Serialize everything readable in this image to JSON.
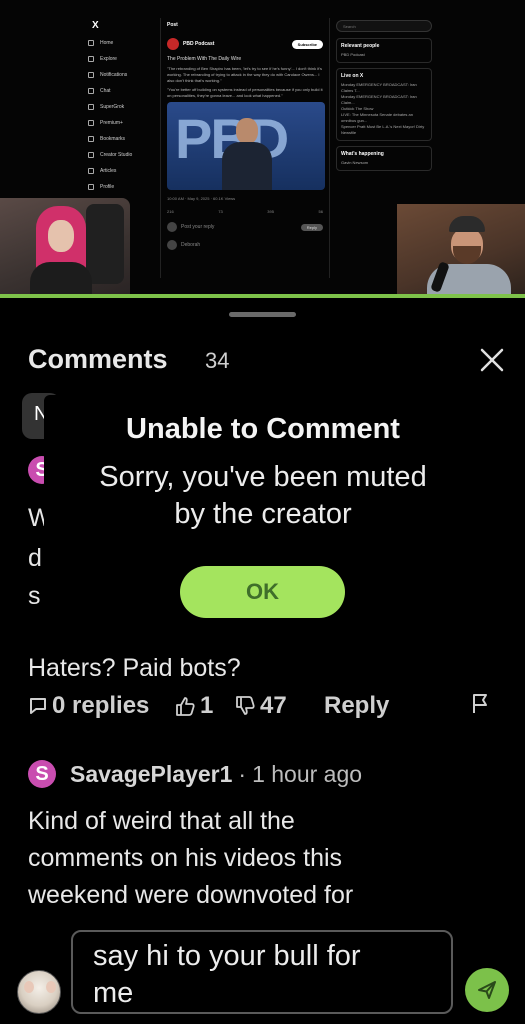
{
  "video": {
    "x_logo": "X",
    "nav": [
      "Home",
      "Explore",
      "Notifications",
      "Chat",
      "SuperGrok",
      "Premium+",
      "Bookmarks",
      "Creator Studio",
      "Articles",
      "Profile"
    ],
    "post": {
      "header": "Post",
      "author": "PBD Podcast",
      "follow": "Subscribe",
      "title": "The Problem With The Daily Wire",
      "text1": "\"The rebranding of Ben Shapiro has been, 'let's try to see if he's funny'... I don't think it's working. The rebranding of trying to attack in the way they do with Candace Owens... I also don't think that's working.\"",
      "text2": "\"You're better off building on systems instead of personalities because if you only build it on personalities, they're gonna leave... and look what happened.\"",
      "image_word": "PBD",
      "meta": "10:00 AM · May 9, 2025 · 60.1K Views",
      "actions": [
        "216",
        "73",
        "395",
        "56"
      ],
      "reply_placeholder": "Post your reply",
      "reply_button": "Reply",
      "reply_author": "Deborah"
    },
    "right": {
      "search": "Search",
      "relevant_title": "Relevant people",
      "relevant_line": "PBD Podcast",
      "live_title": "Live on X",
      "live_lines": [
        "Monday EMERGENCY BROADCAST: Iran Claims T...",
        "Monday EMERGENCY BROADCAST: Iran Claim...",
        "Outkick The Show",
        "LIVE: The Minnesota Senate debates an omnibus gun...",
        "Spencer Pratt Must Be L.A.'s Next Mayor! Dirty Newsfile"
      ],
      "happening_title": "What's happening",
      "happening_line": "Gavin Newsom"
    }
  },
  "comments": {
    "title": "Comments",
    "count": "34",
    "sort_pill_letter": "N",
    "partial_avatar_letter": "S",
    "partial_lines": [
      "W",
      "d",
      "s"
    ],
    "first_comment_last_line": "Haters? Paid bots?",
    "first_actions": {
      "replies": "0 replies",
      "likes": "1",
      "dislikes": "47",
      "reply": "Reply"
    },
    "second_comment": {
      "avatar_letter": "S",
      "author": "SavagePlayer1",
      "separator": "·",
      "time": "1 hour ago",
      "lines": [
        "Kind of weird that all the",
        "comments on his videos this",
        "weekend were downvoted for"
      ]
    }
  },
  "composer": {
    "text_line1": "say hi to your bull for",
    "text_line2": "me"
  },
  "modal": {
    "title": "Unable to Comment",
    "message_line1": "Sorry, you've been muted",
    "message_line2": "by the creator",
    "ok_label": "OK"
  },
  "colors": {
    "accent_green": "#a4e45e",
    "send_green": "#7cc14a",
    "avatar_pink": "#c94db0",
    "background": "#000000"
  },
  "icons": [
    "close-icon",
    "reply-bubble-icon",
    "thumbs-up-icon",
    "thumbs-down-icon",
    "flag-icon",
    "send-icon"
  ]
}
